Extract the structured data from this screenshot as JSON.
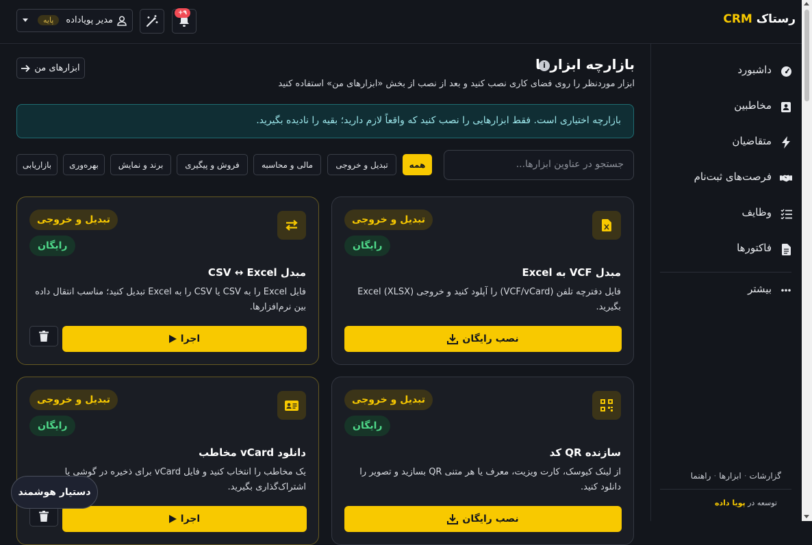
{
  "app": {
    "brand_prefix": "رستاک",
    "brand_suffix": "CRM"
  },
  "topbar": {
    "user_name": "مدیر پویاداده",
    "plan_badge": "پایه",
    "notif_count": "+۹"
  },
  "sidebar": {
    "items": [
      {
        "label": "داشبورد",
        "icon": "dashboard-icon"
      },
      {
        "label": "مخاطبین",
        "icon": "contacts-icon"
      },
      {
        "label": "متقاضیان",
        "icon": "bolt-icon"
      },
      {
        "label": "فرصت‌های ثبت‌نام",
        "icon": "handshake-icon"
      },
      {
        "label": "وظایف",
        "icon": "tasks-icon"
      },
      {
        "label": "فاکتورها",
        "icon": "invoice-icon"
      }
    ],
    "more_label": "بیشتر",
    "footer_links": [
      "گزارشات",
      "ابزارها",
      "راهنما"
    ],
    "dev_prefix": "توسعه در",
    "dev_name": "پویا داده"
  },
  "main": {
    "title": "بازارچه ابزارها",
    "subtitle": "ابزار موردنظر را روی فضای کاری نصب کنید و بعد از نصب از بخش «ابزارهای من» استفاده کنید",
    "my_tools_label": "ابزارهای من",
    "alert_text": "بازارچه اختیاری است. فقط ابزارهایی را نصب کنید که واقعاً لازم دارید؛ بقیه را نادیده بگیرید.",
    "search_placeholder": "جستجو در عناوین ابزارها...",
    "filters": [
      "همه",
      "تبدیل و خروجی",
      "مالی و محاسبه",
      "فروش و پیگیری",
      "برند و نمایش",
      "بهره‌وری",
      "بازاریابی"
    ],
    "active_filter": "همه",
    "cards": [
      {
        "title": "مبدل VCF به Excel",
        "category": "تبدیل و خروجی",
        "price": "رایگان",
        "description": "فایل دفترچه تلفن (VCF/vCard) را آپلود کنید و خروجی Excel (XLSX) بگیرید.",
        "action": "نصب رایگان",
        "installed": false,
        "icon": "excel-file-icon"
      },
      {
        "title": "مبدل CSV ↔ Excel",
        "category": "تبدیل و خروجی",
        "price": "رایگان",
        "description": "فایل Excel را به CSV یا CSV را به Excel تبدیل کنید؛ مناسب انتقال داده بین نرم‌افزارها.",
        "action": "اجرا",
        "installed": true,
        "icon": "swap-arrows-icon"
      },
      {
        "title": "سازنده QR کد",
        "category": "تبدیل و خروجی",
        "price": "رایگان",
        "description": "از لینک کیوسک، کارت ویزیت، معرف یا هر متنی QR بسازید و تصویر را دانلود کنید.",
        "action": "نصب رایگان",
        "installed": false,
        "icon": "qr-code-icon"
      },
      {
        "title": "دانلود vCard مخاطب",
        "category": "تبدیل و خروجی",
        "price": "رایگان",
        "description": "یک مخاطب را انتخاب کنید و فایل vCard برای ذخیره در گوشی یا اشتراک‌گذاری بگیرید.",
        "action": "اجرا",
        "installed": true,
        "icon": "contact-card-icon"
      }
    ]
  },
  "assistant_label": "دستیار هوشمند",
  "colors": {
    "accent": "#f8c900",
    "background": "#13161c",
    "card": "#1a1d24",
    "success": "#4fd98a",
    "danger": "#f24b55"
  }
}
